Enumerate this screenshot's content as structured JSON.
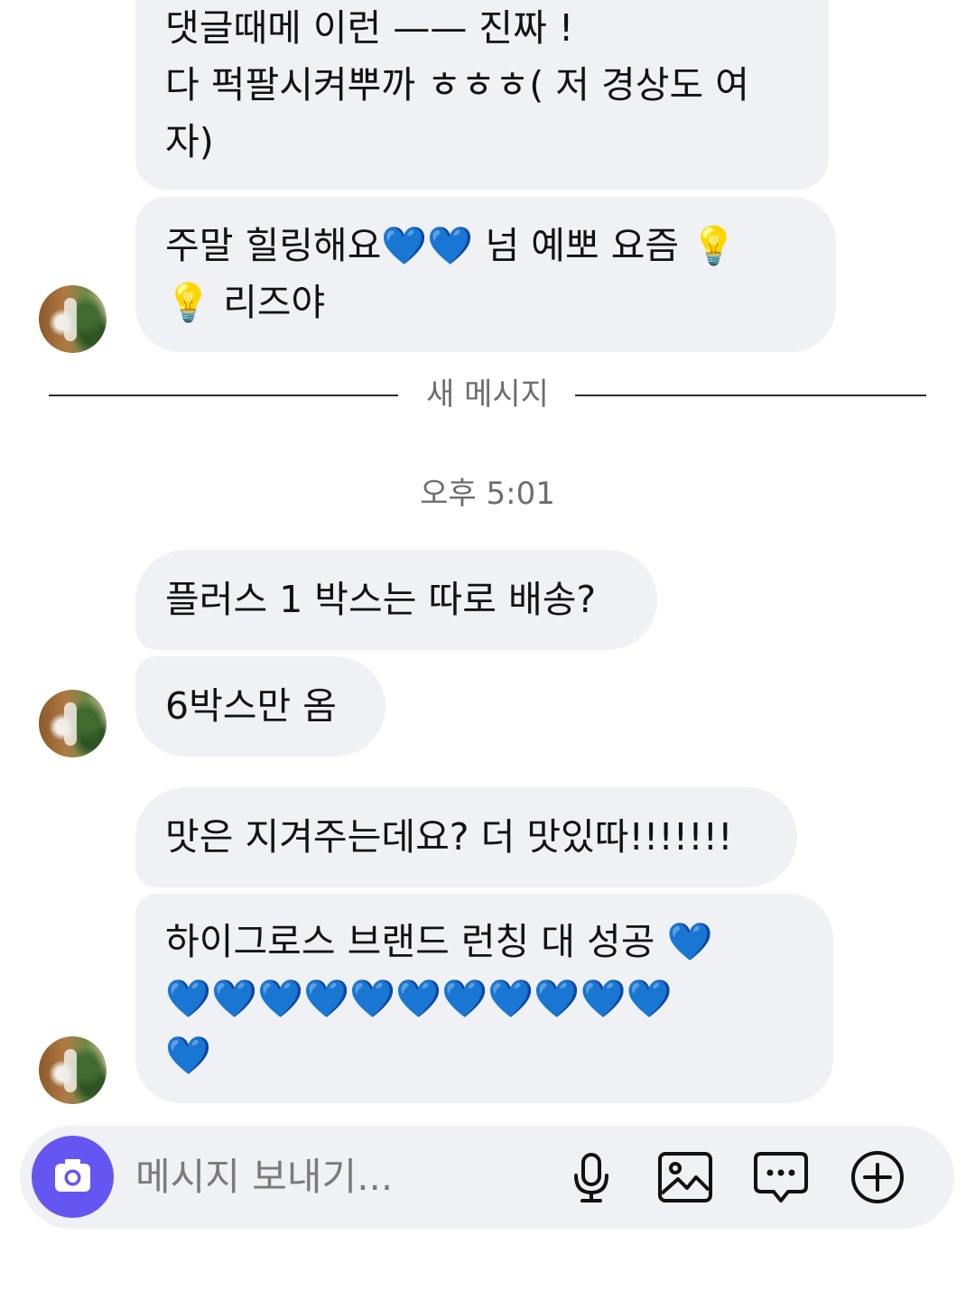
{
  "messages": [
    {
      "lines": [
        "댓글때메 이런 —— 진짜 !",
        "다 퍽팔시켜뿌까 ㅎㅎㅎ( 저 경상도 여",
        "자)"
      ]
    },
    {
      "lines": [
        "주말 힐링해요💙💙 넘 예뽀 요즘 💡",
        "💡 리즈야"
      ]
    },
    {
      "lines": [
        "플러스 1 박스는 따로 배송?"
      ]
    },
    {
      "lines": [
        "6박스만 옴"
      ]
    },
    {
      "lines": [
        "맛은 지겨주는데요? 더 맛있따!!!!!!!"
      ]
    },
    {
      "lines": [
        "하이그로스 브랜드 런칭 대 성공 💙",
        "💙💙💙💙💙💙💙💙💙💙💙",
        "💙"
      ]
    }
  ],
  "divider": {
    "label": "새 메시지"
  },
  "timestamp": "오후 5:01",
  "composer": {
    "placeholder": "메시지 보내기..."
  },
  "icons": {
    "camera": "camera-icon",
    "mic": "microphone-icon",
    "gallery": "image-icon",
    "sticker": "chat-bubble-icon",
    "add": "plus-circle-icon"
  },
  "colors": {
    "bubble": "#eff1f5",
    "camera_button": "#6556f2",
    "heart": "#1a6ff0"
  }
}
